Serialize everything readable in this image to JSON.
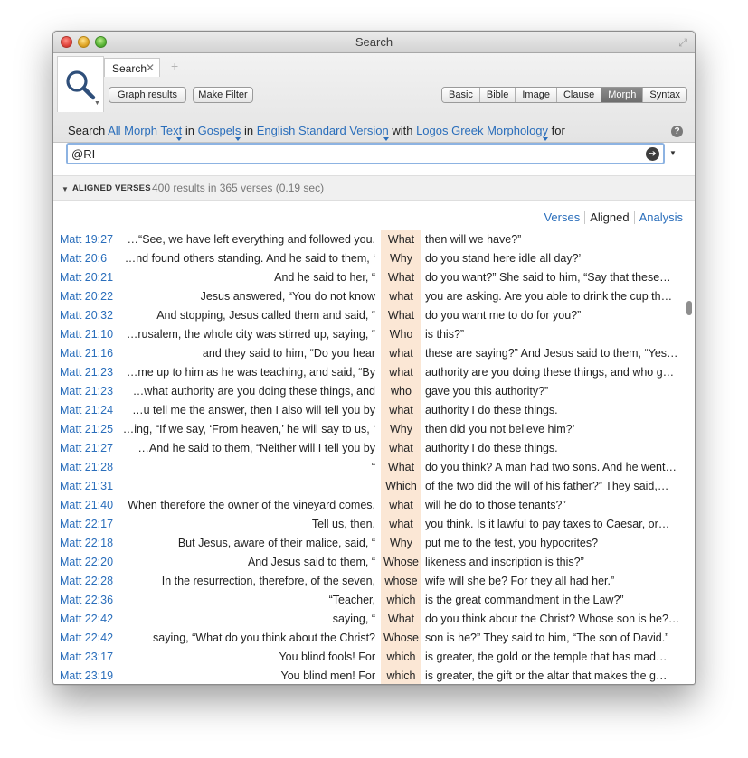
{
  "window": {
    "title": "Search"
  },
  "tabs": [
    {
      "label": "Search"
    }
  ],
  "toolbar": {
    "graph_results": "Graph results",
    "make_filter": "Make Filter",
    "search_types": [
      "Basic",
      "Bible",
      "Image",
      "Clause",
      "Morph",
      "Syntax"
    ],
    "active_type": "Morph"
  },
  "query": {
    "prefix": "Search",
    "scope": "All Morph Text",
    "in1": "in",
    "range": "Gospels",
    "in2": "in",
    "version": "English Standard Version",
    "with": "with",
    "morphology": "Logos Greek Morphology",
    "for": "for",
    "input_value": "@RI"
  },
  "results": {
    "section_label": "ALIGNED VERSES",
    "count_text": "400 results in 365 verses (0.19 sec)",
    "views": [
      "Verses",
      "Aligned",
      "Analysis"
    ],
    "active_view": "Aligned",
    "rows": [
      {
        "ref": "Matt 19:27",
        "before": "…“See, we have left everything and followed you.",
        "hit": "What",
        "after": "then will we have?”"
      },
      {
        "ref": "Matt 20:6",
        "before": "…nd found others standing. And he said to them, ‘",
        "hit": "Why",
        "after": "do you stand here idle all day?’"
      },
      {
        "ref": "Matt 20:21",
        "before": "And he said to her, “",
        "hit": "What",
        "after": "do you want?” She said to him, “Say that these…"
      },
      {
        "ref": "Matt 20:22",
        "before": "Jesus answered, “You do not know",
        "hit": "what",
        "after": "you are asking. Are you able to drink the cup th…"
      },
      {
        "ref": "Matt 20:32",
        "before": "And stopping, Jesus called them and said, “",
        "hit": "What",
        "after": "do you want me to do for you?”"
      },
      {
        "ref": "Matt 21:10",
        "before": "…rusalem, the whole city was stirred up, saying, “",
        "hit": "Who",
        "after": "is this?”"
      },
      {
        "ref": "Matt 21:16",
        "before": "and they said to him, “Do you hear",
        "hit": "what",
        "after": "these are saying?” And Jesus said to them, “Yes…"
      },
      {
        "ref": "Matt 21:23",
        "before": "…me up to him as he was teaching, and said, “By",
        "hit": "what",
        "after": "authority are you doing these things, and who g…"
      },
      {
        "ref": "Matt 21:23",
        "before": "…what authority are you doing these things, and",
        "hit": "who",
        "after": "gave you this authority?”"
      },
      {
        "ref": "Matt 21:24",
        "before": "…u tell me the answer, then I also will tell you by",
        "hit": "what",
        "after": "authority I do these things."
      },
      {
        "ref": "Matt 21:25",
        "before": "…ing, “If we say, ‘From heaven,’ he will say to us, ‘",
        "hit": "Why",
        "after": "then did you not believe him?’"
      },
      {
        "ref": "Matt 21:27",
        "before": "…And he said to them, “Neither will I tell you by",
        "hit": "what",
        "after": "authority I do these things."
      },
      {
        "ref": "Matt 21:28",
        "before": "“",
        "hit": "What",
        "after": "do you think? A man had two sons. And he went…"
      },
      {
        "ref": "Matt 21:31",
        "before": "",
        "hit": "Which",
        "after": "of the two did the will of his father?” They said,…"
      },
      {
        "ref": "Matt 21:40",
        "before": "When therefore the owner of the vineyard comes,",
        "hit": "what",
        "after": "will he do to those tenants?”"
      },
      {
        "ref": "Matt 22:17",
        "before": "Tell us, then,",
        "hit": "what",
        "after": "you think. Is it lawful to pay taxes to Caesar, or…"
      },
      {
        "ref": "Matt 22:18",
        "before": "But Jesus, aware of their malice, said, “",
        "hit": "Why",
        "after": "put me to the test, you hypocrites?"
      },
      {
        "ref": "Matt 22:20",
        "before": "And Jesus said to them, “",
        "hit": "Whose",
        "after": "likeness and inscription is this?”"
      },
      {
        "ref": "Matt 22:28",
        "before": "In the resurrection, therefore, of the seven,",
        "hit": "whose",
        "after": "wife will she be? For they all had her.”"
      },
      {
        "ref": "Matt 22:36",
        "before": "“Teacher,",
        "hit": "which",
        "after": "is the great commandment in the Law?”"
      },
      {
        "ref": "Matt 22:42",
        "before": "saying, “",
        "hit": "What",
        "after": "do you think about the Christ? Whose son is he?…"
      },
      {
        "ref": "Matt 22:42",
        "before": "saying, “What do you think about the Christ?",
        "hit": "Whose",
        "after": "son is he?” They said to him, “The son of David.”"
      },
      {
        "ref": "Matt 23:17",
        "before": "You blind fools! For",
        "hit": "which",
        "after": "is greater, the gold or the temple that has mad…"
      },
      {
        "ref": "Matt 23:19",
        "before": "You blind men! For",
        "hit": "which",
        "after": "is greater, the gift or the altar that makes the g…"
      }
    ]
  }
}
